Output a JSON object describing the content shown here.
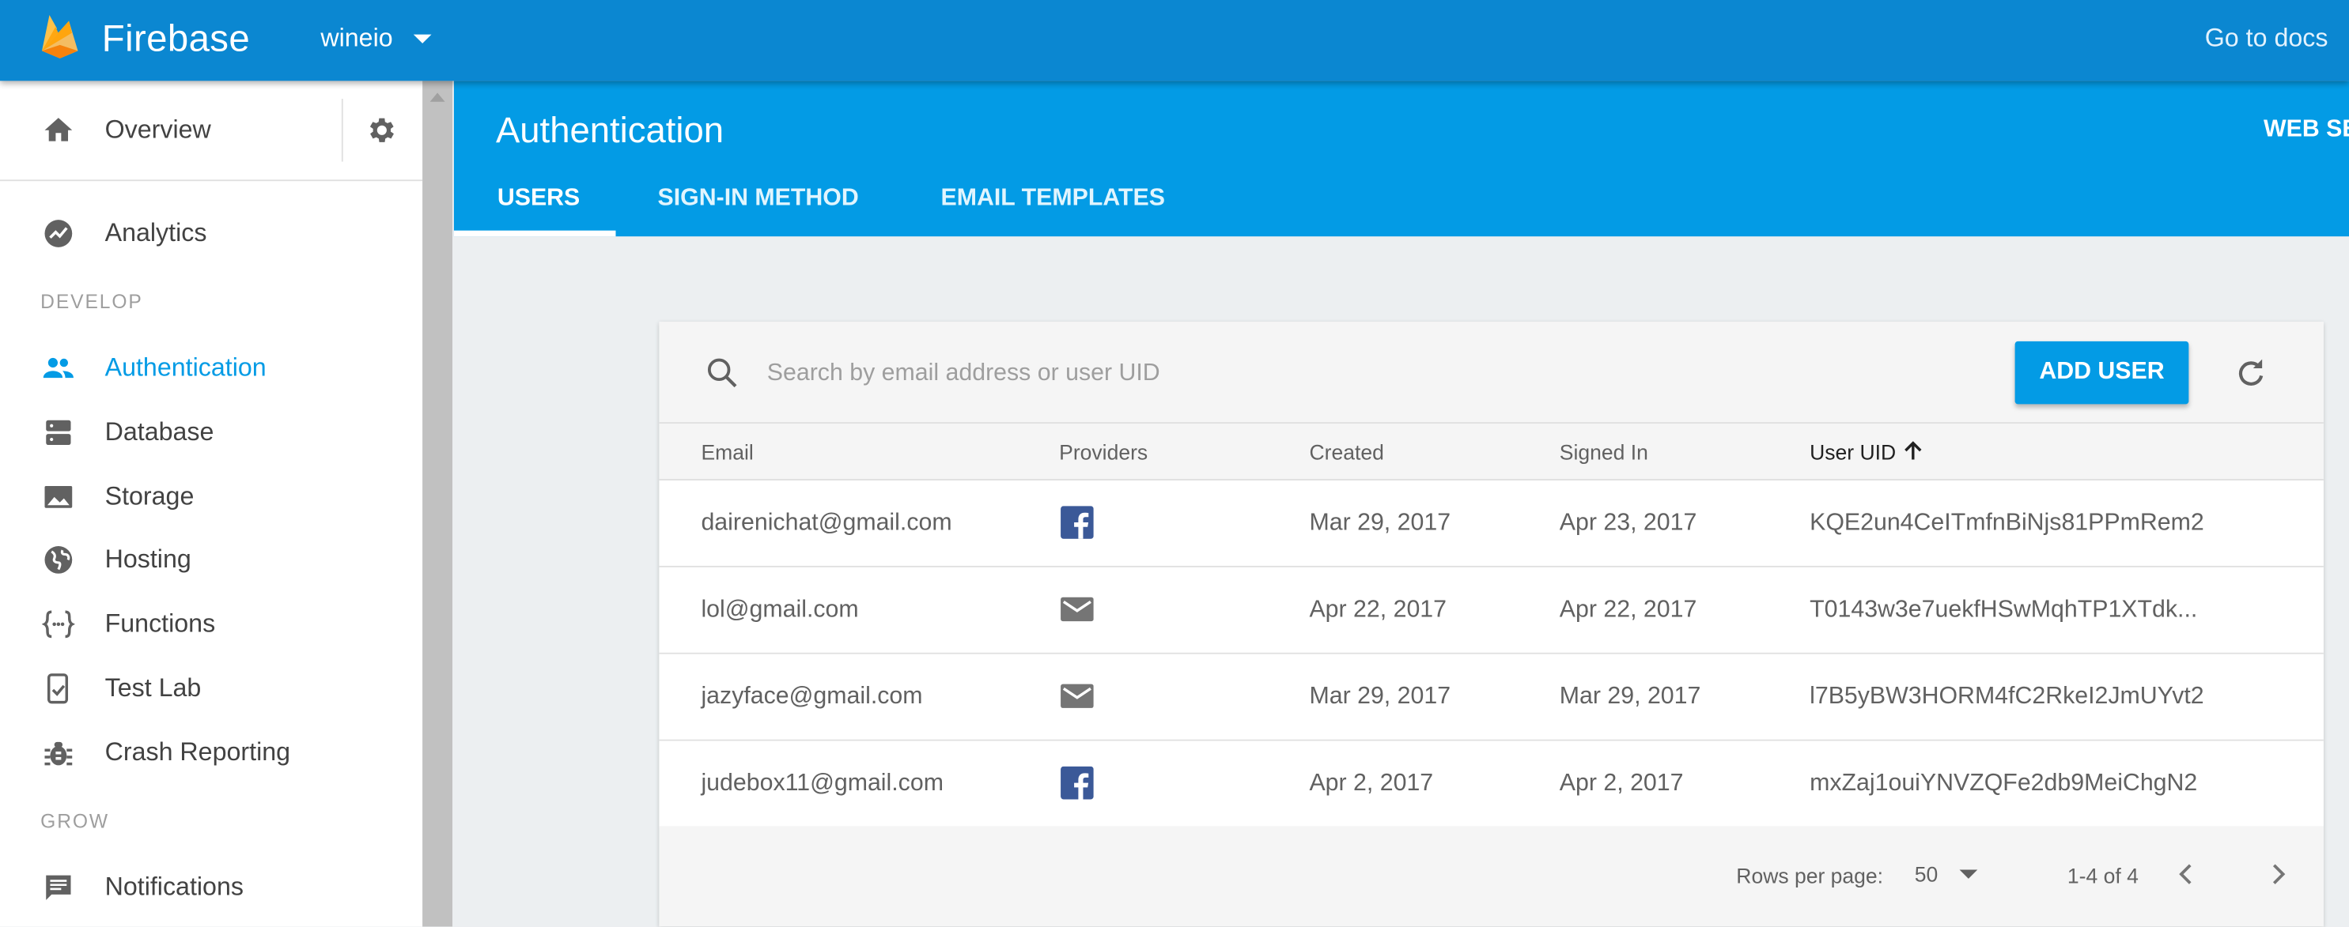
{
  "app": {
    "brand": "Firebase",
    "project": "wineio",
    "docs_link": "Go to docs"
  },
  "sidebar": {
    "overview_label": "Overview",
    "items": [
      {
        "label": "Analytics"
      },
      {
        "label": "Authentication",
        "active": true
      },
      {
        "label": "Database"
      },
      {
        "label": "Storage"
      },
      {
        "label": "Hosting"
      },
      {
        "label": "Functions"
      },
      {
        "label": "Test Lab"
      },
      {
        "label": "Crash Reporting"
      },
      {
        "label": "Notifications"
      }
    ],
    "sections": {
      "develop": "DEVELOP",
      "grow": "GROW"
    }
  },
  "header": {
    "title": "Authentication",
    "right_text": "WEB SE",
    "tabs": [
      {
        "label": "USERS",
        "active": true
      },
      {
        "label": "SIGN-IN METHOD"
      },
      {
        "label": "EMAIL TEMPLATES"
      }
    ]
  },
  "toolbar": {
    "search_placeholder": "Search by email address or user UID",
    "add_user_label": "ADD USER"
  },
  "table": {
    "columns": [
      "Email",
      "Providers",
      "Created",
      "Signed In",
      "User UID"
    ],
    "sorted_column": "User UID",
    "rows": [
      {
        "email": "dairenichat@gmail.com",
        "provider": "facebook-icon",
        "created": "Mar 29, 2017",
        "signed_in": "Apr 23, 2017",
        "uid": "KQE2un4CeITmfnBiNjs81PPmRem2"
      },
      {
        "email": "lol@gmail.com",
        "provider": "email-icon",
        "created": "Apr 22, 2017",
        "signed_in": "Apr 22, 2017",
        "uid": "T0143w3e7uekfHSwMqhTP1XTdk..."
      },
      {
        "email": "jazyface@gmail.com",
        "provider": "email-icon",
        "created": "Mar 29, 2017",
        "signed_in": "Mar 29, 2017",
        "uid": "l7B5yBW3HORM4fC2RkeI2JmUYvt2"
      },
      {
        "email": "judebox11@gmail.com",
        "provider": "facebook-icon",
        "created": "Apr 2, 2017",
        "signed_in": "Apr 2, 2017",
        "uid": "mxZaj1ouiYNVZQFe2db9MeiChgN2"
      }
    ]
  },
  "pagination": {
    "rows_per_page_label": "Rows per page:",
    "rows_per_page_value": "50",
    "range": "1-4 of 4"
  },
  "colors": {
    "topbar": "#0b87d1",
    "header": "#039be5",
    "accent": "#039be5",
    "facebook": "#3b5998"
  }
}
